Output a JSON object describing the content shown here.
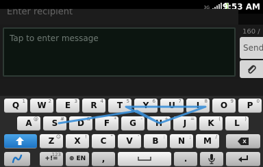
{
  "status_bar": {
    "network_label": "3G",
    "time": "9:53 AM"
  },
  "recipient": {
    "placeholder": "Enter recipient"
  },
  "compose": {
    "placeholder": "Tap to enter message",
    "counter": "160 / 1",
    "send_label": "Send"
  },
  "keyboard": {
    "row1": [
      {
        "label": "Q",
        "sup": "1"
      },
      {
        "label": "W",
        "sup": "2"
      },
      {
        "label": "E",
        "sup": "3"
      },
      {
        "label": "R",
        "sup": "4"
      },
      {
        "label": "T",
        "sup": "5"
      },
      {
        "label": "Y",
        "sup": "6"
      },
      {
        "label": "U",
        "sup": "7"
      },
      {
        "label": "I",
        "sup": "8"
      },
      {
        "label": "O",
        "sup": "9"
      },
      {
        "label": "P",
        "sup": "0"
      }
    ],
    "row2": [
      {
        "label": "A",
        "sup": "@"
      },
      {
        "label": "S",
        "sup": "#"
      },
      {
        "label": "D",
        "sup": "&"
      },
      {
        "label": "F",
        "sup": "*"
      },
      {
        "label": "G",
        "sup": "-"
      },
      {
        "label": "H",
        "sup": "+"
      },
      {
        "label": "J",
        "sup": "="
      },
      {
        "label": "K",
        "sup": "("
      },
      {
        "label": "L",
        "sup": ")"
      }
    ],
    "row3": [
      {
        "label": "Z",
        "sup": "☺"
      },
      {
        "label": "X",
        "sup": "!"
      },
      {
        "label": "C",
        "sup": "\""
      },
      {
        "label": "V",
        "sup": "'"
      },
      {
        "label": "B",
        "sup": ":"
      },
      {
        "label": "N",
        "sup": ";"
      },
      {
        "label": "M",
        "sup": "/"
      }
    ],
    "symbols_label": "+!=",
    "symbols_sup": "123",
    "language_label": "EN",
    "comma_label": ",",
    "period_label": ".",
    "swype_icon": "swype-logo-icon",
    "shift_icon": "shift-arrow-icon",
    "backspace_icon": "backspace-icon",
    "mic_icon": "microphone-icon",
    "enter_icon": "enter-arrow-icon",
    "space_icon": "space-bar-icon",
    "swipe_trace_color": "#3a8fd8",
    "shift_color": "#1d74c4"
  }
}
